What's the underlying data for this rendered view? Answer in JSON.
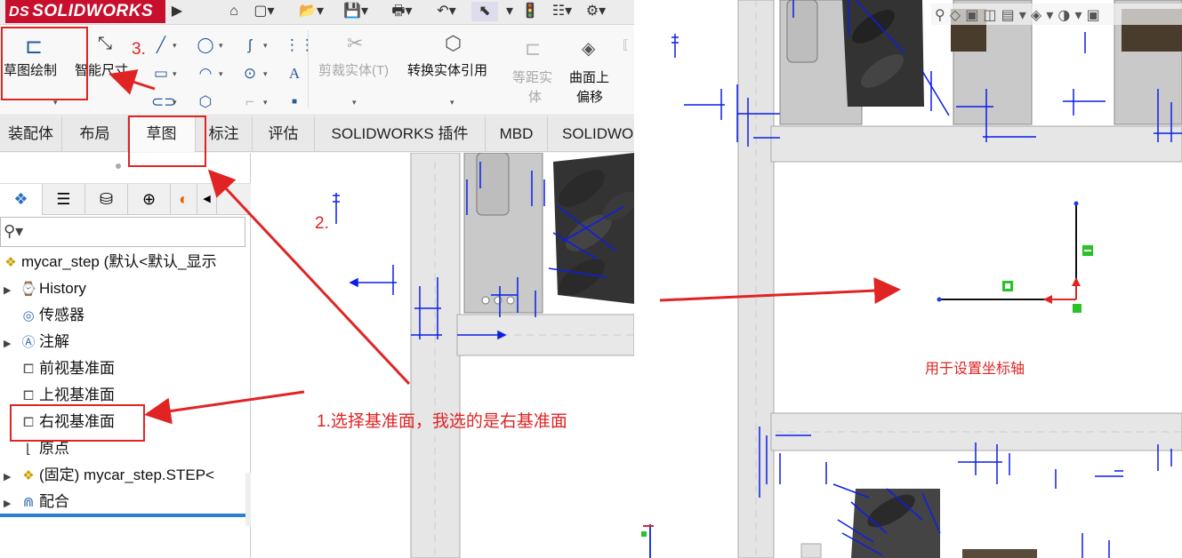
{
  "app": {
    "logo_ds": "DS",
    "logo_text": "SOLIDWORKS"
  },
  "ribbon": {
    "sketch": "草图绘制",
    "smart_dimension": "智能尺寸",
    "trim": "剪裁实体(T)",
    "convert": "转换实体引用",
    "offset_line1": "等距实",
    "offset_line2": "体",
    "surface_offset_line1": "曲面上",
    "surface_offset_line2": "偏移"
  },
  "tabs": [
    "装配体",
    "布局",
    "草图",
    "标注",
    "评估",
    "SOLIDWORKS 插件",
    "MBD",
    "SOLIDWO"
  ],
  "tree": {
    "root": "mycar_step  (默认<默认_显示",
    "items": [
      "History",
      "传感器",
      "注解",
      "前视基准面",
      "上视基准面",
      "右视基准面",
      "原点",
      "(固定) mycar_step.STEP<",
      "配合"
    ]
  },
  "annotations": {
    "step1": "1.选择基准面，我选的是右基准面",
    "step2": "2.",
    "step3": "3.",
    "right_note": "用于设置坐标轴"
  },
  "colors": {
    "accent_red": "#e02424",
    "sw_red": "#c8102e",
    "dim_blue": "#0a1ee8"
  }
}
